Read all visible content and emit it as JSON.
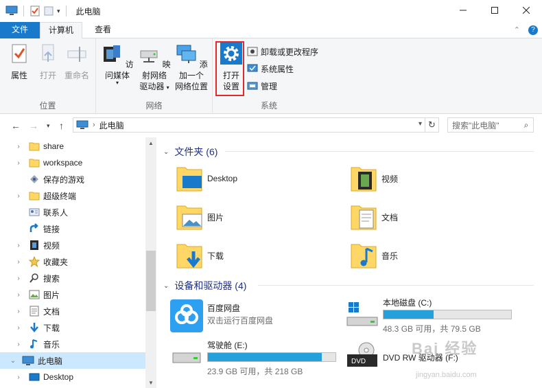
{
  "window": {
    "title": "此电脑"
  },
  "tabs": [
    {
      "label": "文件"
    },
    {
      "label": "计算机"
    },
    {
      "label": "查看"
    }
  ],
  "ribbon": {
    "location_group": {
      "label": "位置",
      "properties": "属性",
      "open": "打开",
      "rename": "重命名"
    },
    "network_group": {
      "label": "网络",
      "access_media": "访问媒体",
      "map_drive_1": "映射网络",
      "map_drive_2": "驱动器",
      "add_location_1": "添加一个",
      "add_location_2": "网络位置"
    },
    "system_group": {
      "label": "系统",
      "open_settings_1": "打开",
      "open_settings_2": "设置",
      "uninstall": "卸载或更改程序",
      "system_properties": "系统属性",
      "manage": "管理"
    }
  },
  "address": {
    "path": "此电脑",
    "search_placeholder": "搜索\"此电脑\""
  },
  "nav_tree": [
    {
      "label": "share",
      "icon": "folder-icon"
    },
    {
      "label": "workspace",
      "icon": "folder-icon"
    },
    {
      "label": "保存的游戏",
      "icon": "saved-games-icon"
    },
    {
      "label": "超级终端",
      "icon": "folder-icon"
    },
    {
      "label": "联系人",
      "icon": "contacts-icon"
    },
    {
      "label": "链接",
      "icon": "links-icon"
    },
    {
      "label": "视频",
      "icon": "video-icon"
    },
    {
      "label": "收藏夹",
      "icon": "star-icon"
    },
    {
      "label": "搜索",
      "icon": "search-icon"
    },
    {
      "label": "图片",
      "icon": "pictures-icon"
    },
    {
      "label": "文档",
      "icon": "documents-icon"
    },
    {
      "label": "下载",
      "icon": "download-icon"
    },
    {
      "label": "音乐",
      "icon": "music-icon"
    },
    {
      "label": "此电脑",
      "icon": "computer-icon"
    },
    {
      "label": "Desktop",
      "icon": "desktop-icon"
    }
  ],
  "folders_section": {
    "title": "文件夹 (6)"
  },
  "folders": [
    {
      "label": "Desktop"
    },
    {
      "label": "视频"
    },
    {
      "label": "图片"
    },
    {
      "label": "文档"
    },
    {
      "label": "下载"
    },
    {
      "label": "音乐"
    }
  ],
  "devices_section": {
    "title": "设备和驱动器 (4)"
  },
  "drives": [
    {
      "name": "百度网盘",
      "sub": "双击运行百度网盘"
    },
    {
      "name": "本地磁盘 (C:)",
      "sub": "48.3 GB 可用，共 79.5 GB",
      "used_fraction": 0.39
    },
    {
      "name": "驾驶舱 (E:)",
      "sub": "23.9 GB 可用，共 218 GB",
      "used_fraction": 0.89
    },
    {
      "name": "DVD RW 驱动器 (F:)",
      "sub": ""
    }
  ],
  "watermark": {
    "text": "Bai 经验",
    "sub": "jingyan.baidu.com"
  },
  "colors": {
    "accent": "#1979ca",
    "highlight": "#e02a2a",
    "bar": "#26a0da",
    "selected": "#cce8ff"
  }
}
